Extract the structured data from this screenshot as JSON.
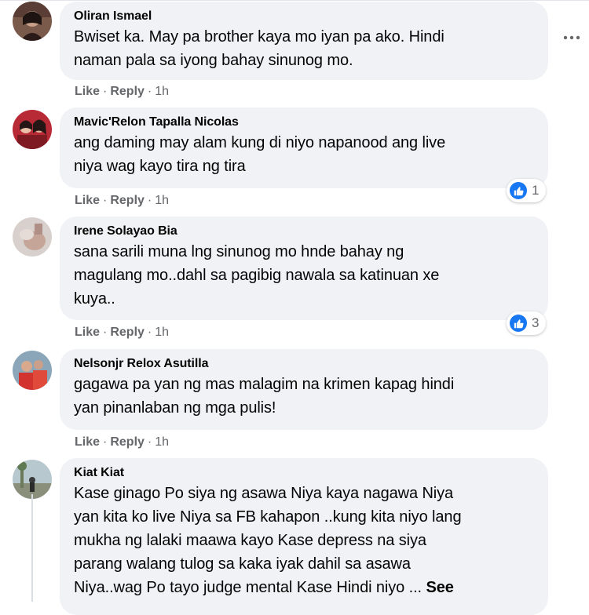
{
  "comments": [
    {
      "author": "Oliran Ismael",
      "text": "Bwiset ka. May pa brother kaya mo iyan pa ako. Hindi\nnaman pala sa iyong bahay sinunog mo.",
      "like": "Like",
      "reply": "Reply",
      "time": "1h"
    },
    {
      "author": "Mavic'Relon Tapalla Nicolas",
      "text": "ang daming may alam kung di niyo napanood ang live\nniya wag kayo tira ng tira",
      "like": "Like",
      "reply": "Reply",
      "time": "1h",
      "reactions": "1"
    },
    {
      "author": "Irene Solayao Bia",
      "text": "sana sarili muna lng sinunog mo hnde bahay ng\nmagulang mo..dahl sa pagibig nawala sa katinuan xe\nkuya..",
      "like": "Like",
      "reply": "Reply",
      "time": "1h",
      "reactions": "3"
    },
    {
      "author": "Nelsonjr Relox Asutilla",
      "text": "gagawa pa yan ng mas malagim na krimen kapag hindi\nyan pinanlaban ng mga pulis!",
      "like": "Like",
      "reply": "Reply",
      "time": "1h"
    },
    {
      "author": "Kiat Kiat",
      "text": "Kase ginago Po siya ng asawa Niya kaya nagawa Niya\nyan kita ko live Niya sa FB kahapon ..kung kita niyo lang\nmukha ng lalaki maawa kayo Kase depress na siya\nparang walang tulog sa kaka iyak dahil sa asawa\nNiya..wag Po tayo judge mental Kase Hindi niyo ...",
      "see_more": "See"
    }
  ],
  "separator": "·",
  "colors": {
    "bubble": "#f0f2f5",
    "meta_text": "#65676b",
    "like_blue": "#1877f2"
  }
}
